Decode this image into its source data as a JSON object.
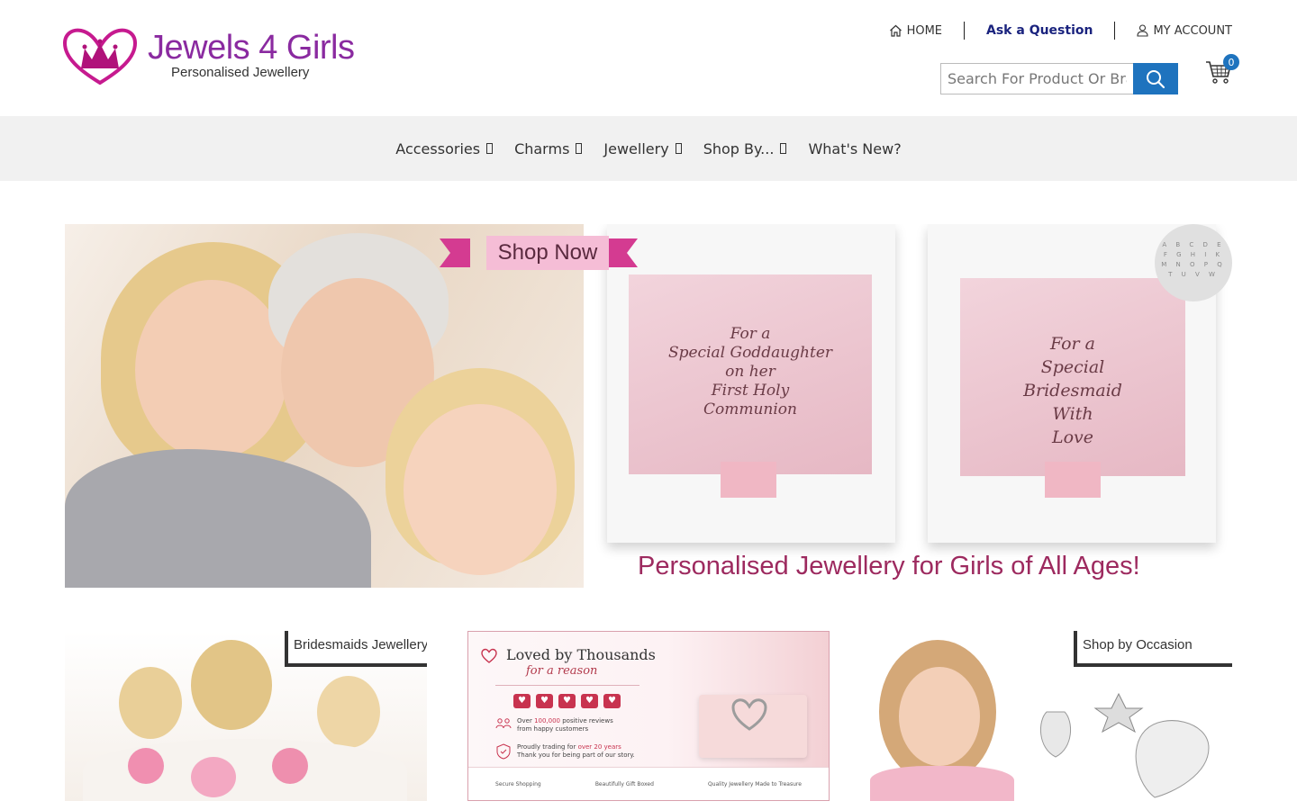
{
  "brand": {
    "title": "Jewels 4 Girls",
    "subtitle": "Personalised Jewellery"
  },
  "toplinks": {
    "home": "HOME",
    "ask": "Ask a Question",
    "account": "MY ACCOUNT"
  },
  "search": {
    "placeholder": "Search For Product Or Brand"
  },
  "cart": {
    "count": "0"
  },
  "nav": {
    "items": [
      "Accessories",
      "Charms",
      "Jewellery",
      "Shop By...",
      "What's New?"
    ]
  },
  "hero": {
    "shop_now": "Shop Now",
    "caption": "Personalised Jewellery for Girls of All Ages!",
    "box1": [
      "For a",
      "Special Goddaughter",
      "on her",
      "First Holy",
      "Communion"
    ],
    "box2": [
      "For a",
      "Special",
      "Bridesmaid",
      "With",
      "Love"
    ]
  },
  "banners": {
    "bridesmaids": "Bridesmaids Jewellery",
    "loved_title": "Loved by Thousands",
    "loved_sub": "for a reason",
    "review_line1_pre": "Over ",
    "review_line1_em": "100,000",
    "review_line1_post": " positive reviews",
    "review_line2": "from happy customers",
    "trading_line1_pre": "Proudly trading for ",
    "trading_line1_em": "over 20 years",
    "trading_line2": "Thank you for being part of our story.",
    "feature1": "Secure Shopping",
    "feature2": "Beautifully Gift Boxed",
    "feature3": "Quality Jewellery Made to Treasure",
    "occasion": "Shop by Occasion"
  },
  "colors": {
    "brand_purple": "#8a2aa0",
    "accent_blue": "#1e73be",
    "nav_bg": "#f1f1f1",
    "caption_pink": "#9d2a5f"
  }
}
